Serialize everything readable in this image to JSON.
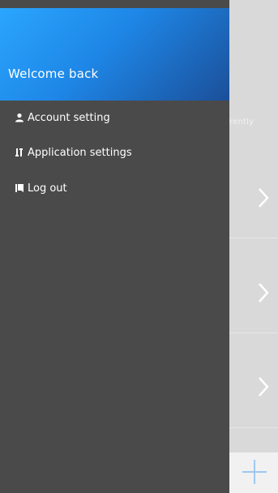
{
  "drawer": {
    "header_title": "Welcome back",
    "items": [
      {
        "label": "Account setting",
        "icon": "user-icon"
      },
      {
        "label": "Application settings",
        "icon": "tools-icon"
      },
      {
        "label": "Log out",
        "icon": "logout-icon"
      }
    ]
  },
  "background": {
    "partial_text": "rently",
    "chevrons": 3,
    "add_icon": "plus-icon"
  },
  "colors": {
    "drawer_bg": "#4a4a4a",
    "header_gradient_start": "#2aa6ff",
    "header_gradient_end": "#1b4f99",
    "background_app": "#d9d9d9"
  }
}
